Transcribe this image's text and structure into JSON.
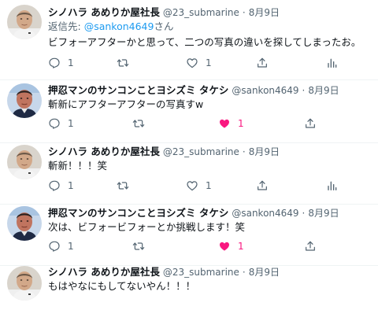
{
  "tweets": [
    {
      "name": "シノハラ あめりか屋社長",
      "handle": "@23_submarine",
      "separator": "·",
      "date": "8月9日",
      "reply_prefix": "返信先: ",
      "reply_mention": "@sankon4649",
      "reply_suffix": "さん",
      "text": "ビフォーアフターかと思って、二つの写真の違いを探してしまったお。",
      "reply_count": "1",
      "retweet_count": "",
      "like_count": "1",
      "liked": false,
      "avatar": "shinohara"
    },
    {
      "name": "押忍マンのサンコンことヨシズミ タケシ",
      "handle": "@sankon4649",
      "separator": "·",
      "date": "8月9日",
      "text": "斬新にアフターアフターの写真すw",
      "reply_count": "1",
      "retweet_count": "",
      "like_count": "1",
      "liked": true,
      "avatar": "yoshizumi"
    },
    {
      "name": "シノハラ あめりか屋社長",
      "handle": "@23_submarine",
      "separator": "·",
      "date": "8月9日",
      "text": "斬新！！！笑",
      "reply_count": "1",
      "retweet_count": "",
      "like_count": "1",
      "liked": false,
      "avatar": "shinohara"
    },
    {
      "name": "押忍マンのサンコンことヨシズミ タケシ",
      "handle": "@sankon4649",
      "separator": "·",
      "date": "8月9日",
      "text": "次は、ビフォービフォーとか挑戦します！笑",
      "reply_count": "1",
      "retweet_count": "",
      "like_count": "1",
      "liked": true,
      "avatar": "yoshizumi"
    },
    {
      "name": "シノハラ あめりか屋社長",
      "handle": "@23_submarine",
      "separator": "·",
      "date": "8月9日",
      "text": "もはやなにもしてないやん！！！",
      "avatar": "shinohara"
    }
  ],
  "colors": {
    "text": "#0f1419",
    "secondary": "#536471",
    "link": "#1d9bf0",
    "like_active": "#f91880"
  },
  "icons": [
    "reply-icon",
    "retweet-icon",
    "like-icon",
    "share-icon",
    "analytics-icon"
  ]
}
